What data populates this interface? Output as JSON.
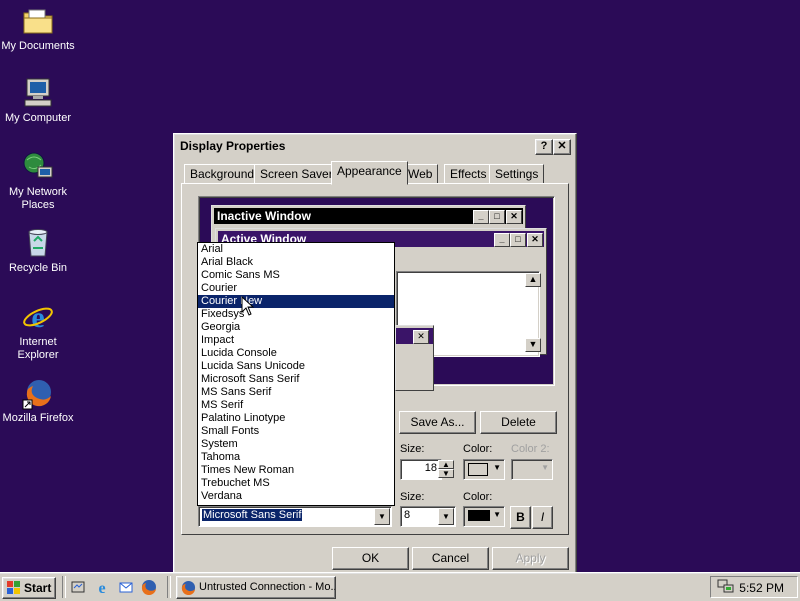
{
  "desktop": {
    "icons": [
      {
        "label": "My Documents",
        "icon": "folder-icon"
      },
      {
        "label": "My Computer",
        "icon": "computer-icon"
      },
      {
        "label": "My Network Places",
        "icon": "network-icon"
      },
      {
        "label": "Recycle Bin",
        "icon": "recycle-bin-icon"
      },
      {
        "label": "Internet Explorer",
        "icon": "internet-explorer-icon"
      },
      {
        "label": "Mozilla Firefox",
        "icon": "firefox-icon"
      }
    ]
  },
  "dialog": {
    "title": "Display Properties",
    "help_btn": "?",
    "close_btn": "✕",
    "tabs": [
      {
        "label": "Background"
      },
      {
        "label": "Screen Saver"
      },
      {
        "label": "Appearance",
        "active": true
      },
      {
        "label": "Web"
      },
      {
        "label": "Effects"
      },
      {
        "label": "Settings"
      }
    ],
    "preview": {
      "inactive_title": "Inactive Window",
      "active_title": "Active Window"
    },
    "buttons": {
      "save_as": "Save As...",
      "delete": "Delete",
      "ok": "OK",
      "cancel": "Cancel",
      "apply": "Apply"
    },
    "item_row": {
      "size_label": "Size:",
      "size_value": "18",
      "color_label": "Color:",
      "color2_label": "Color 2:"
    },
    "font_row": {
      "font_value": "Microsoft Sans Serif",
      "size_label": "Size:",
      "size_value": "8",
      "color_label": "Color:",
      "bold_label": "B",
      "italic_label": "I"
    },
    "font_list": {
      "selected": "Courier New",
      "items": [
        "Arial",
        "Arial Black",
        "Comic Sans MS",
        "Courier",
        "Courier New",
        "Fixedsys",
        "Georgia",
        "Impact",
        "Lucida Console",
        "Lucida Sans Unicode",
        "Microsoft Sans Serif",
        "MS Sans Serif",
        "MS Serif",
        "Palatino Linotype",
        "Small Fonts",
        "System",
        "Tahoma",
        "Times New Roman",
        "Trebuchet MS",
        "Verdana"
      ]
    }
  },
  "taskbar": {
    "start_label": "Start",
    "task_label": "Untrusted Connection - Mo...",
    "clock": "5:52 PM"
  },
  "colors": {
    "desktop": "#2b0b57",
    "face": "#d4d0c8",
    "selection": "#0a246a",
    "active_title": "#3a1468",
    "inactive_title": "#000000"
  }
}
